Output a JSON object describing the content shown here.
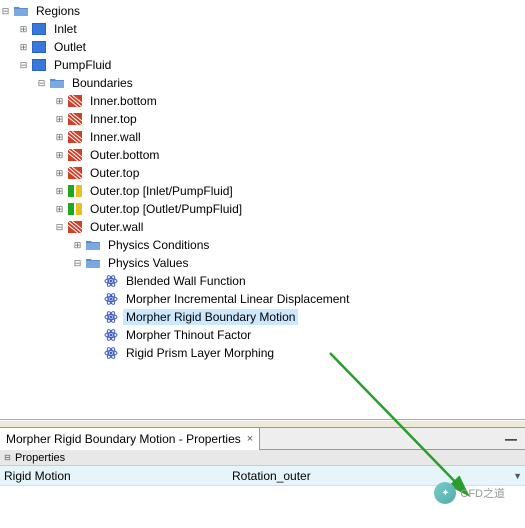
{
  "tree": {
    "root": "Regions",
    "inlet": "Inlet",
    "outlet": "Outlet",
    "pumpfluid": "PumpFluid",
    "boundaries": "Boundaries",
    "innerbottom": "Inner.bottom",
    "innertop": "Inner.top",
    "innerwall": "Inner.wall",
    "outerbottom": "Outer.bottom",
    "outertop": "Outer.top",
    "outertopinlet": "Outer.top [Inlet/PumpFluid]",
    "outertopoutlet": "Outer.top [Outlet/PumpFluid]",
    "outerwall": "Outer.wall",
    "physicsconditions": "Physics Conditions",
    "physicsvalues": "Physics Values",
    "blendedwall": "Blended Wall Function",
    "morpherinc": "Morpher Incremental Linear Displacement",
    "morpherrigid": "Morpher Rigid Boundary Motion",
    "morpherthin": "Morpher Thinout Factor",
    "rigidprism": "Rigid Prism Layer Morphing"
  },
  "panel": {
    "title": "Morpher Rigid Boundary Motion - Properties",
    "section": "Properties",
    "prop_label": "Rigid Motion",
    "prop_value": "Rotation_outer"
  },
  "watermark": "CFD之道",
  "icons": {
    "folder_color": "#e8b048",
    "region_color": "#2864c8",
    "boundary_hatch": "#2864c8",
    "interface_color": "#1ea81e",
    "physics_color": "#4060c0"
  }
}
